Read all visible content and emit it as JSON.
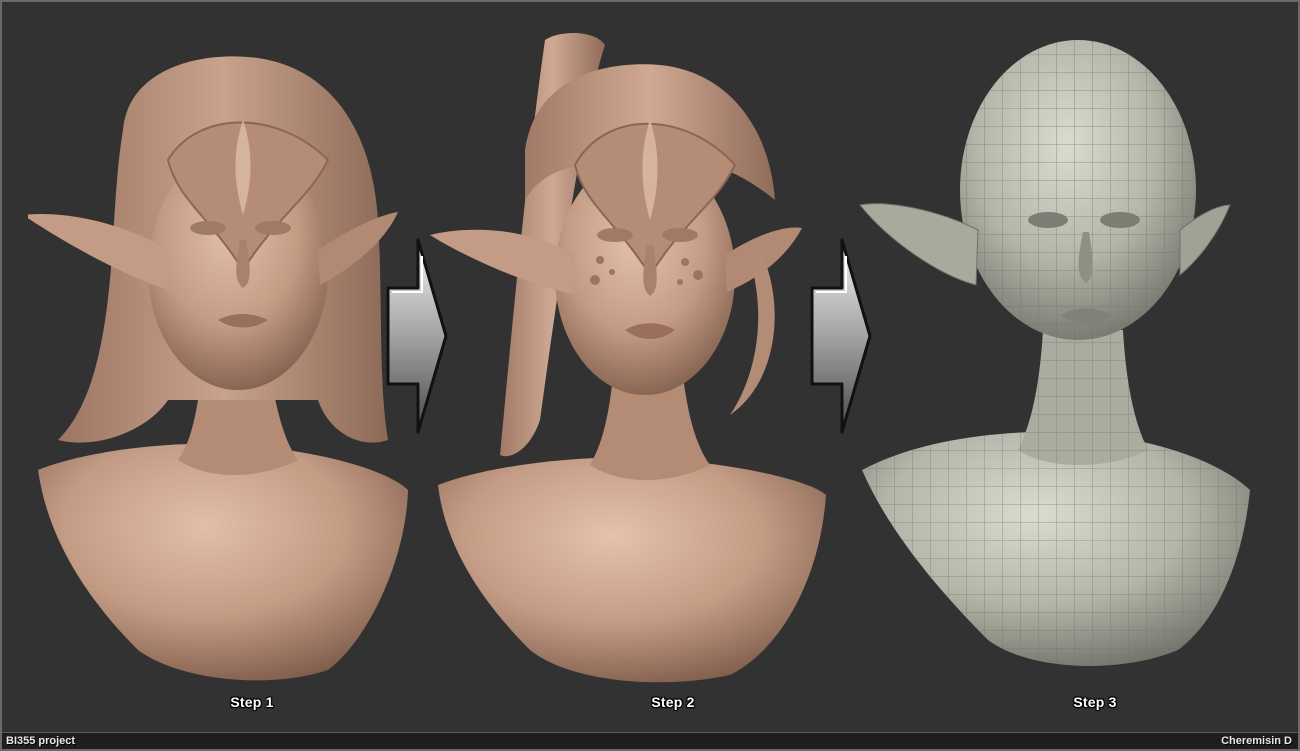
{
  "steps": [
    {
      "label": "Step 1"
    },
    {
      "label": "Step 2"
    },
    {
      "label": "Step 3"
    }
  ],
  "footer": {
    "project": "BI355 project",
    "author": "Cheremisin D"
  },
  "colors": {
    "background": "#323232",
    "clay": "#c9a18a",
    "clay_shadow": "#8a6654",
    "mesh": "#b9bcae",
    "mesh_line": "#6e7266",
    "arrow_light": "#f2f2f2",
    "arrow_dark": "#555555"
  }
}
